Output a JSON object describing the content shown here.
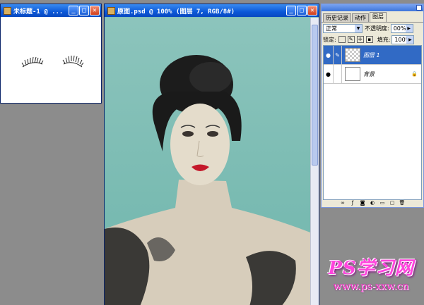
{
  "small_window": {
    "title": "未标题-1 @ ..."
  },
  "main_window": {
    "title": "原图.psd @ 100% (图层 7, RGB/8#)"
  },
  "window_buttons": {
    "minimize": "_",
    "maximize": "□",
    "close": "✕"
  },
  "layers_panel": {
    "tabs": [
      "历史记录",
      "动作",
      "图层"
    ],
    "active_tab": 2,
    "blend_mode": "正常",
    "opacity_label": "不透明度:",
    "opacity_value": "00%",
    "lock_label": "锁定:",
    "fill_label": "填充:",
    "fill_value": "100%",
    "layers": [
      {
        "name": "图层 1",
        "selected": true,
        "thumbnail": "transparent"
      },
      {
        "name": "背景",
        "selected": false,
        "thumbnail": "white",
        "locked": true
      }
    ],
    "bottom_icons": [
      "link-icon",
      "fx-icon",
      "mask-icon",
      "adjustment-icon",
      "group-icon",
      "new-layer-icon",
      "delete-icon"
    ]
  },
  "watermark": {
    "logo": "PS学习网",
    "url": "www.ps-xxw.cn"
  },
  "colors": {
    "titlebar": "#0b58d8",
    "canvas_bg": "#7fbeb5",
    "workspace": "#8c8c8c",
    "selected_layer": "#316ac5",
    "watermark": "#ff44dd"
  }
}
